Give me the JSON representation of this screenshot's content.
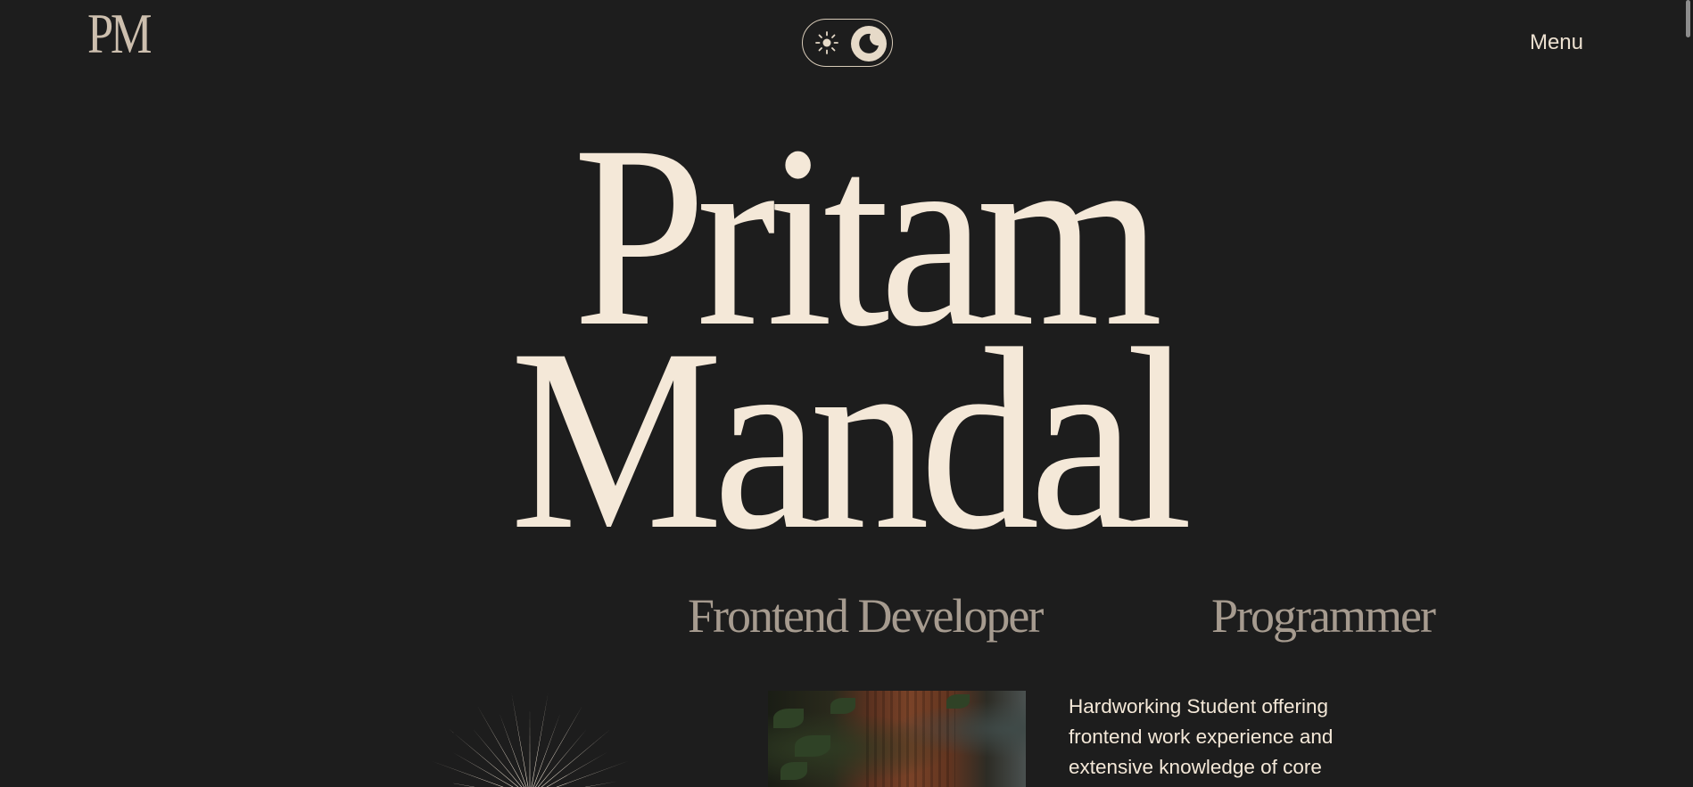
{
  "header": {
    "logo_text": "PM",
    "theme_toggle": {
      "light_icon": "sun-icon",
      "dark_icon": "moon-icon",
      "active": "dark"
    },
    "menu_label": "Menu"
  },
  "hero": {
    "first_name": "Pritam",
    "last_name": "Mandal",
    "roles": [
      "Frontend Developer",
      "Programmer"
    ]
  },
  "intro": {
    "text": "Hardworking Student offering frontend work experience and extensive knowledge of core"
  },
  "decor": {
    "starburst_icon": "sunburst-icon",
    "photo": "interior-plant-photo"
  },
  "colors": {
    "background": "#1d1d1d",
    "cream": "#f4e8d8",
    "muted": "#a69b8f"
  }
}
